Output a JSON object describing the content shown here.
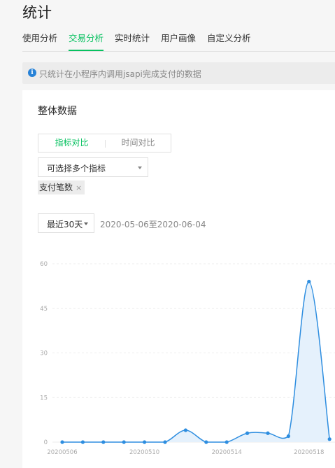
{
  "page_title": "统计",
  "tabs": [
    {
      "label": "使用分析",
      "active": false
    },
    {
      "label": "交易分析",
      "active": true
    },
    {
      "label": "实时统计",
      "active": false
    },
    {
      "label": "用户画像",
      "active": false
    },
    {
      "label": "自定义分析",
      "active": false
    }
  ],
  "notice": {
    "icon": "info-icon",
    "text": "只统计在小程序内调用jsapi完成支付的数据"
  },
  "card": {
    "title": "整体数据",
    "segment": {
      "active_label": "指标对比",
      "inactive_label": "时间对比"
    },
    "metric_select": {
      "label": "可选择多个指标"
    },
    "selected_tag": {
      "label": "支付笔数",
      "close": "×"
    },
    "range_select": {
      "label": "最近30天"
    },
    "date_range": "2020-05-06至2020-06-04"
  },
  "colors": {
    "accent": "#07c160",
    "line": "#2e8ee0",
    "area": "#e5f1fc",
    "info": "#2782d7"
  },
  "chart_data": {
    "type": "area",
    "title": "",
    "xlabel": "",
    "ylabel": "",
    "ylim": [
      0,
      60
    ],
    "y_ticks": [
      "0",
      "15",
      "30",
      "45",
      "60"
    ],
    "x_tick_labels": [
      "20200506",
      "20200510",
      "20200514",
      "20200518"
    ],
    "x": [
      "20200506",
      "20200507",
      "20200508",
      "20200509",
      "20200510",
      "20200511",
      "20200512",
      "20200513",
      "20200514",
      "20200515",
      "20200516",
      "20200517",
      "20200518",
      "20200519"
    ],
    "series": [
      {
        "values": [
          0,
          0,
          0,
          0,
          0,
          0,
          4,
          0,
          0,
          3,
          3,
          2,
          54,
          1
        ]
      }
    ],
    "grid": true,
    "smooth": true
  }
}
